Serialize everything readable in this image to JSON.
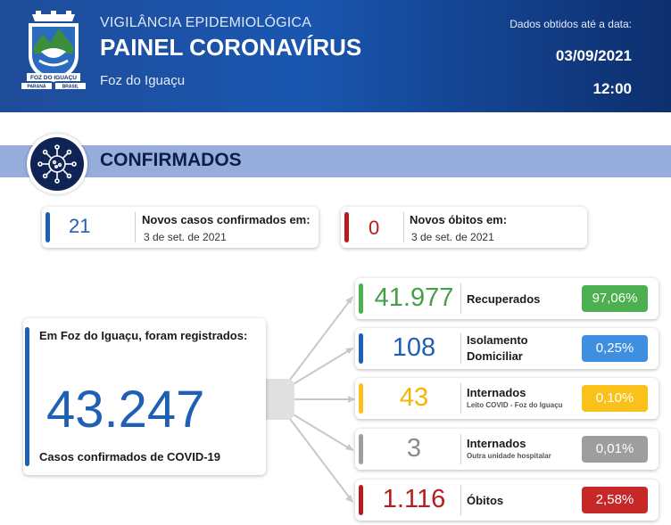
{
  "header": {
    "subtitle": "VIGILÂNCIA EPIDEMIOLÓGICA",
    "title": "PAINEL CORONAVÍRUS",
    "city": "Foz do Iguaçu",
    "data_label": "Dados obtidos até a data:",
    "date": "03/09/2021",
    "time": "12:00",
    "logo_text": {
      "banner": "FOZ DO IGUAÇU",
      "left": "PARANÁ",
      "right": "BRASIL"
    }
  },
  "section": {
    "title": "CONFIRMADOS",
    "icon": "virus-icon"
  },
  "new_cases": {
    "value": "21",
    "label": "Novos casos confirmados em:",
    "date": "3 de set. de 2021",
    "accent": "#1f5fb5"
  },
  "new_deaths": {
    "value": "0",
    "label": "Novos óbitos em:",
    "date": "3 de set. de 2021",
    "accent": "#b71c1c"
  },
  "total": {
    "label": "Em Foz do Iguaçu, foram registrados:",
    "value": "43.247",
    "sublabel": "Casos confirmados de COVID-19",
    "accent": "#1f5fb5"
  },
  "rows": [
    {
      "value": "41.977",
      "label": "Recuperados",
      "sublabel": "",
      "percent": "97,06%",
      "color": "#4caf50",
      "num_color": "#43a047"
    },
    {
      "value": "108",
      "label": "Isolamento Domiciliar",
      "sublabel": "",
      "percent": "0,25%",
      "color": "#3f8fe0",
      "num_color": "#1f5fb5"
    },
    {
      "value": "43",
      "label": "Internados",
      "sublabel": "Leito COVID - Foz do Iguaçu",
      "percent": "0,10%",
      "color": "#f9c11a",
      "num_color": "#f2b705"
    },
    {
      "value": "3",
      "label": "Internados",
      "sublabel": "Outra unidade hospitalar",
      "percent": "0,01%",
      "color": "#9e9e9e",
      "num_color": "#8c8c8c"
    },
    {
      "value": "1.116",
      "label": "Óbitos",
      "sublabel": "",
      "percent": "2,58%",
      "color": "#c62828",
      "num_color": "#b71c1c"
    }
  ]
}
